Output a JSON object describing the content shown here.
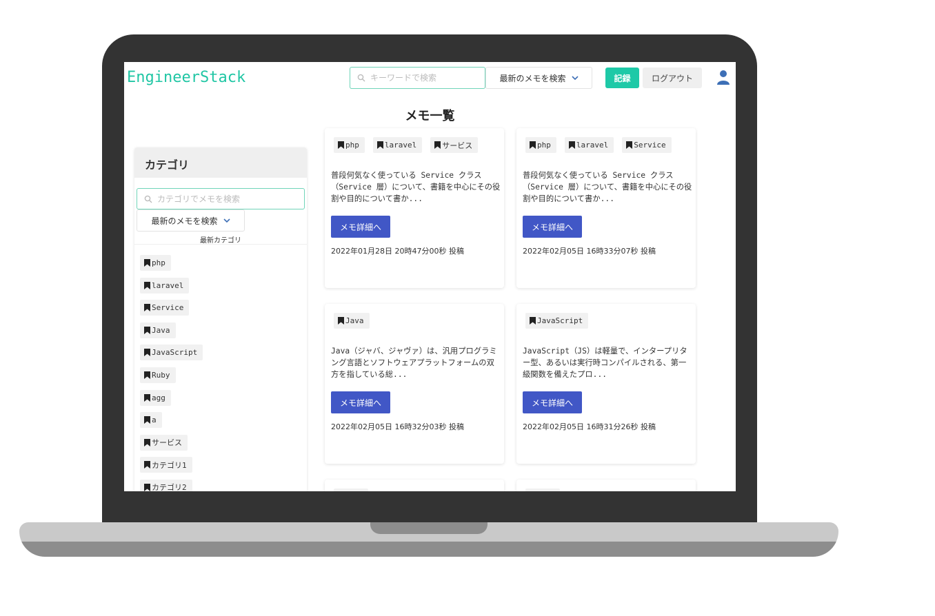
{
  "header": {
    "logo": "EngineerStack",
    "search_placeholder": "キーワードで検索",
    "sort_label": "最新のメモを検索",
    "record_label": "記録",
    "logout_label": "ログアウト"
  },
  "page_title": "メモ一覧",
  "sidebar": {
    "title": "カテゴリ",
    "search_placeholder": "カテゴリでメモを検索",
    "sort_label": "最新のメモを検索",
    "recent_label": "最新カテゴリ",
    "categories": [
      "php",
      "laravel",
      "Service",
      "Java",
      "JavaScript",
      "Ruby",
      "agg",
      "a",
      "サービス",
      "カテゴリ1",
      "カテゴリ2"
    ]
  },
  "memos": [
    {
      "tags": [
        "php",
        "laravel",
        "サービス"
      ],
      "excerpt": "普段何気なく使っている Service クラス（Service 層）について、書籍を中心にその役割や目的について書か...",
      "button": "メモ詳細へ",
      "date": "2022年01月28日 20時47分00秒 投稿"
    },
    {
      "tags": [
        "php",
        "laravel",
        "Service"
      ],
      "excerpt": "普段何気なく使っている Service クラス（Service 層）について、書籍を中心にその役割や目的について書か...",
      "button": "メモ詳細へ",
      "date": "2022年02月05日 16時33分07秒 投稿"
    },
    {
      "tags": [
        "Java"
      ],
      "excerpt": "Java（ジャバ、ジャヴァ）は、汎用プログラミング言語とソフトウェアプラットフォームの双方を指している総...",
      "button": "メモ詳細へ",
      "date": "2022年02月05日 16時32分03秒 投稿"
    },
    {
      "tags": [
        "JavaScript"
      ],
      "excerpt": "JavaScript（JS）は軽量で、インタープリター型、あるいは実行時コンパイルされる、第一級関数を備えたプロ...",
      "button": "メモ詳細へ",
      "date": "2022年02月05日 16時31分26秒 投稿"
    }
  ],
  "colors": {
    "brand": "#20c6a4",
    "record_button": "#1ec9a7",
    "detail_button": "#4157c6",
    "user_icon": "#3d6fb6",
    "laptop_frame": "#333333"
  },
  "icons": {
    "search": "search-icon",
    "chevron": "chevron-down-icon",
    "user": "user-icon",
    "bookmark": "bookmark-icon"
  }
}
